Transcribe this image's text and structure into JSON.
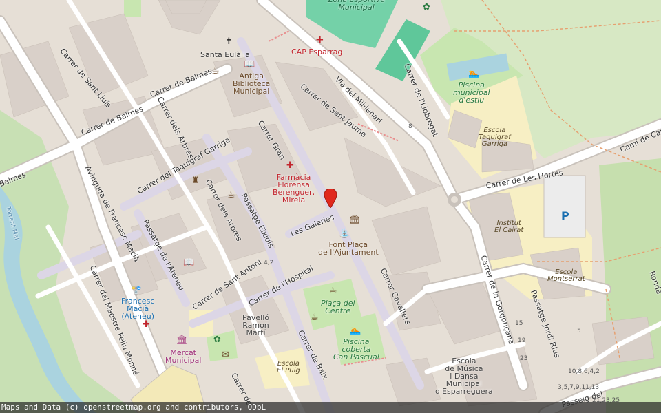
{
  "map": {
    "attribution": "Maps and Data (c) openstreetmap.org and contributors, ODbL",
    "colors": {
      "background": "#e6dfd6",
      "road": "#ffffff",
      "road_casing": "#c9c2bb",
      "pedestrian": "#dcd6e6",
      "park": "#c8e6b0",
      "sports": "#74d1a8",
      "school": "#f7efc4",
      "water": "#aad3df",
      "marker": "#e0281d"
    },
    "streets": [
      {
        "name": "Carrer de Sant Lluís"
      },
      {
        "name": "Carrer de Balmes"
      },
      {
        "name": "Carrer de Balmes"
      },
      {
        "name": "Balmes"
      },
      {
        "name": "Carrer dels Arbres"
      },
      {
        "name": "Carrer del Taquígraf Garriga"
      },
      {
        "name": "Avinguda de Francesc Macià"
      },
      {
        "name": "Carrer dels Arbres"
      },
      {
        "name": "Passatge Eixidis"
      },
      {
        "name": "Carrer Gran"
      },
      {
        "name": "Carrer de Sant Jaume"
      },
      {
        "name": "Via del Mil·lenari"
      },
      {
        "name": "Carrer de l'Llobregat"
      },
      {
        "name": "Carrer de Les Hortes"
      },
      {
        "name": "Camí de Can"
      },
      {
        "name": "Les Galeries"
      },
      {
        "name": "Passatge de l'Ateneu"
      },
      {
        "name": "Carrer de Sant Antoni"
      },
      {
        "name": "Carrer de l'Hospital"
      },
      {
        "name": "Carrer del Maestre Feliu Monné"
      },
      {
        "name": "Carrer de Baix"
      },
      {
        "name": "Carrer Cavallers"
      },
      {
        "name": "Carrer de la Gorgonçana"
      },
      {
        "name": "Passatge Jordi Rius"
      },
      {
        "name": "Passeig del"
      },
      {
        "name": "Carrer de"
      },
      {
        "name": "Torrent Mal"
      },
      {
        "name": "Ronda"
      }
    ],
    "pois": [
      {
        "name": "Santa Eulàlia",
        "icon": "church-icon"
      },
      {
        "name": "Antiga\nBiblioteca\nMunicipal",
        "icon": "library-icon"
      },
      {
        "name": "CAP Esparrag",
        "icon": "clinic-icon"
      },
      {
        "name": "Zona Esportiva\nMunicipal",
        "icon": "none"
      },
      {
        "name": "Piscina\nmunicipal\nd'estiu",
        "icon": "swimming-icon"
      },
      {
        "name": "Escola\nTaquígraf\nGarriga",
        "icon": "none"
      },
      {
        "name": "Farmàcia\nFlorensa\nBerenguer,\nMireia",
        "icon": "pharmacy-icon"
      },
      {
        "name": "Institut\nEl Cairat",
        "icon": "none"
      },
      {
        "name": "Escola\nMontserrat",
        "icon": "none"
      },
      {
        "name": "Font Plaça\nde l'Ajuntament",
        "icon": "fountain-icon"
      },
      {
        "name": "Plaça del\nCentre",
        "icon": "none"
      },
      {
        "name": "Pavelló\nRamon\nMartí",
        "icon": "none"
      },
      {
        "name": "Piscina\ncoberta\nCan Pascual",
        "icon": "swimming-icon"
      },
      {
        "name": "Escola\nEl Puig",
        "icon": "none"
      },
      {
        "name": "Escola\nde Música\ni Dansa\nMunicipal\nd'Esparreguera",
        "icon": "none"
      },
      {
        "name": "Francesc\nMacià\n(Ateneu)",
        "icon": "bus-stop-icon"
      },
      {
        "name": "Mercat\nMunicipal",
        "icon": "market-icon"
      }
    ],
    "house_numbers": [
      "8",
      "4,2",
      "15",
      "19",
      "23",
      "5",
      "10,8,6,4,2",
      "3,5,7,9,11,13",
      "21,23,25"
    ]
  }
}
